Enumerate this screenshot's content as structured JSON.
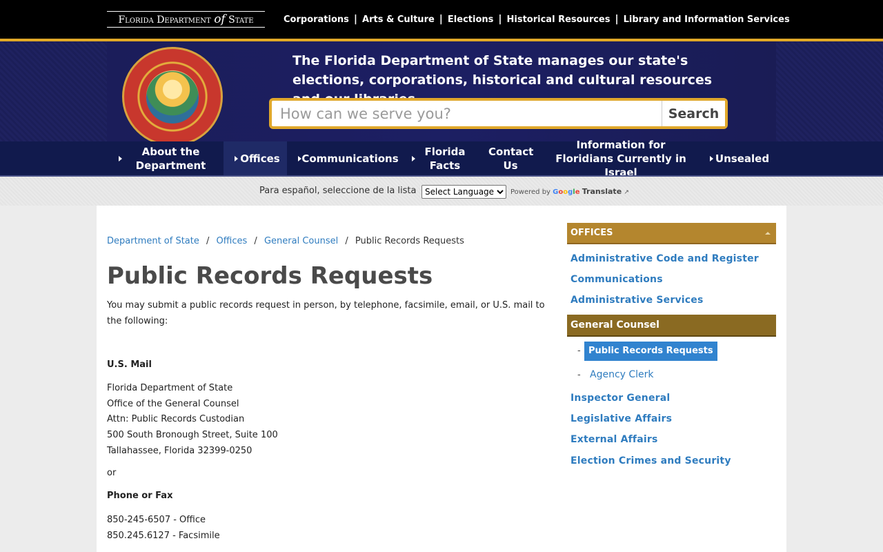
{
  "top": {
    "logo_prefix": "Florida Department",
    "logo_of": "of",
    "logo_suffix": "State",
    "links": [
      "Corporations",
      "Arts & Culture",
      "Elections",
      "Historical Resources",
      "Library and Information Services"
    ],
    "separator": "|"
  },
  "banner": {
    "seal_text": "GREAT SEAL OF THE STATE OF FLORIDA",
    "tagline": "The Florida Department of State manages our state's elections, corporations, historical and cultural resources and our libraries.",
    "search_placeholder": "How can we serve you?",
    "search_button": "Search"
  },
  "nav": {
    "items": [
      {
        "label": "About the Department"
      },
      {
        "label": "Offices"
      },
      {
        "label": "Communications"
      },
      {
        "label": "Florida Facts"
      },
      {
        "label": "Contact Us"
      },
      {
        "label": "Information for Floridians Currently in Israel"
      },
      {
        "label": "Unsealed"
      }
    ]
  },
  "translate": {
    "label": "Para español, seleccione de la lista",
    "select_value": "Select Language",
    "powered_by": "Powered by",
    "translate_label": "Translate"
  },
  "breadcrumb": {
    "items": [
      "Department of State",
      "Offices",
      "General Counsel"
    ],
    "current": "Public Records Requests",
    "separator": "/"
  },
  "content": {
    "title": "Public Records Requests",
    "intro": "You may submit a public records request in person, by telephone, facsimile, email, or U.S. mail to the following:",
    "mail_heading": "U.S. Mail",
    "address_lines": [
      "Florida Department of State",
      "Office of the General Counsel",
      "Attn: Public Records Custodian",
      "500 South Bronough Street, Suite 100",
      "Tallahassee, Florida 32399-0250"
    ],
    "or": "or",
    "phone_heading": "Phone or Fax",
    "phone_lines": [
      "850-245-6507 - Office",
      "850.245.6127 - Facsimile"
    ]
  },
  "sidebar": {
    "heading": "OFFICES",
    "links_top": [
      "Administrative Code and Register",
      "Communications",
      "Administrative Services"
    ],
    "active_section": "General Counsel",
    "sub_current": "Public Records Requests",
    "sub_other": "Agency Clerk",
    "sub_dash": "-",
    "links_bottom": [
      "Inspector General",
      "Legislative Affairs",
      "External Affairs",
      "Election Crimes and Security"
    ]
  }
}
